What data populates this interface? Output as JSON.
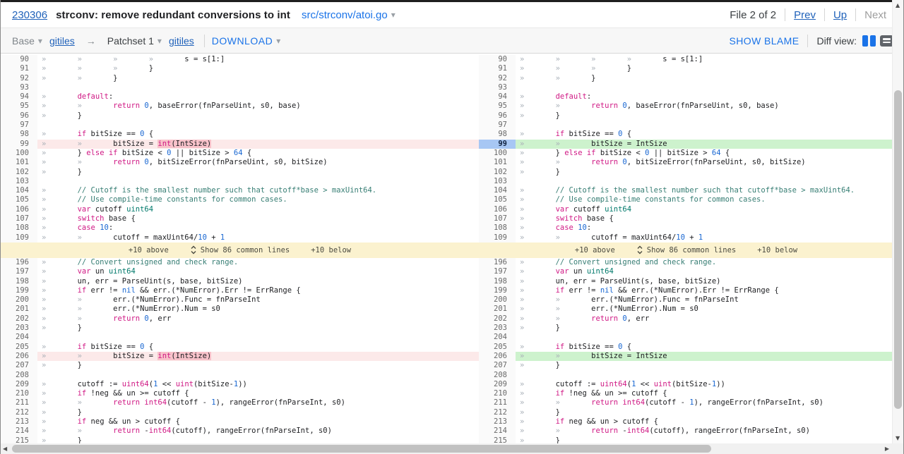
{
  "header": {
    "change_number": "230306",
    "title": "strconv: remove redundant conversions to int",
    "file_path": "src/strconv/atoi.go",
    "file_counter": "File 2 of 2",
    "prev": "Prev",
    "up": "Up",
    "next": "Next"
  },
  "toolbar": {
    "base_label": "Base",
    "gitiles_left": "gitiles",
    "arrow": "→",
    "patchset_label": "Patchset 1",
    "gitiles_right": "gitiles",
    "download": "DOWNLOAD",
    "show_blame": "SHOW BLAME",
    "diff_view_label": "Diff view:"
  },
  "colors": {
    "keyword": "#d01884",
    "number": "#1967d2",
    "type_teal": "#00796b",
    "comment": "#377e74",
    "link_blue": "#2062ba",
    "action_blue": "#1a73e8",
    "removed_bg": "#fce9e9",
    "removed_intraline": "#f8c2ca",
    "added_bg": "#cdf2cd",
    "expand_bg": "#fbf2cf",
    "selected_line_bg": "#a7c7f4",
    "gutter_bg": "#fafafa"
  },
  "diff": {
    "expand": {
      "above": "+10 above",
      "show": "Show 86 common lines",
      "below": "+10 below"
    },
    "rows": [
      {
        "n": 90,
        "s": [
          [
            "tab",
            "»       »       »       »       "
          ],
          [
            "p",
            "s = s[1:]"
          ]
        ]
      },
      {
        "n": 91,
        "s": [
          [
            "tab",
            "»       »       »       "
          ],
          [
            "p",
            "}"
          ]
        ]
      },
      {
        "n": 92,
        "s": [
          [
            "tab",
            "»       »       "
          ],
          [
            "p",
            "}"
          ]
        ]
      },
      {
        "n": 93,
        "s": []
      },
      {
        "n": 94,
        "s": [
          [
            "tab",
            "»       "
          ],
          [
            "k",
            "default"
          ],
          [
            "p",
            ":"
          ]
        ]
      },
      {
        "n": 95,
        "s": [
          [
            "tab",
            "»       »       "
          ],
          [
            "k",
            "return"
          ],
          [
            "p",
            " "
          ],
          [
            "n",
            "0"
          ],
          [
            "p",
            ", baseError(fnParseUint, s0, base)"
          ]
        ]
      },
      {
        "n": 96,
        "s": [
          [
            "tab",
            "»       "
          ],
          [
            "p",
            "}"
          ]
        ]
      },
      {
        "n": 97,
        "s": []
      },
      {
        "n": 98,
        "s": [
          [
            "tab",
            "»       "
          ],
          [
            "k",
            "if"
          ],
          [
            "p",
            " bitSize == "
          ],
          [
            "n",
            "0"
          ],
          [
            "p",
            " {"
          ]
        ]
      },
      {
        "n": 99,
        "lt": "removed",
        "rt": "added",
        "rsel": true,
        "ls": [
          [
            "tab",
            "»       »       "
          ],
          [
            "p",
            "bitSize = "
          ],
          [
            "kh",
            "int"
          ],
          [
            "ph",
            "(IntSize)"
          ]
        ],
        "rs": [
          [
            "tab",
            "»       »       "
          ],
          [
            "p",
            "bitSize = IntSize"
          ]
        ]
      },
      {
        "n": 100,
        "s": [
          [
            "tab",
            "»       "
          ],
          [
            "p",
            "} "
          ],
          [
            "k",
            "else"
          ],
          [
            "p",
            " "
          ],
          [
            "k",
            "if"
          ],
          [
            "p",
            " bitSize < "
          ],
          [
            "n",
            "0"
          ],
          [
            "p",
            " || bitSize > "
          ],
          [
            "n",
            "64"
          ],
          [
            "p",
            " {"
          ]
        ]
      },
      {
        "n": 101,
        "s": [
          [
            "tab",
            "»       »       "
          ],
          [
            "k",
            "return"
          ],
          [
            "p",
            " "
          ],
          [
            "n",
            "0"
          ],
          [
            "p",
            ", bitSizeError(fnParseUint, s0, bitSize)"
          ]
        ]
      },
      {
        "n": 102,
        "s": [
          [
            "tab",
            "»       "
          ],
          [
            "p",
            "}"
          ]
        ]
      },
      {
        "n": 103,
        "s": []
      },
      {
        "n": 104,
        "s": [
          [
            "tab",
            "»       "
          ],
          [
            "c",
            "// Cutoff is the smallest number such that cutoff*base > maxUint64."
          ]
        ]
      },
      {
        "n": 105,
        "s": [
          [
            "tab",
            "»       "
          ],
          [
            "c",
            "// Use compile-time constants for common cases."
          ]
        ]
      },
      {
        "n": 106,
        "s": [
          [
            "tab",
            "»       "
          ],
          [
            "k",
            "var"
          ],
          [
            "p",
            " cutoff "
          ],
          [
            "t",
            "uint64"
          ]
        ]
      },
      {
        "n": 107,
        "s": [
          [
            "tab",
            "»       "
          ],
          [
            "k",
            "switch"
          ],
          [
            "p",
            " base {"
          ]
        ]
      },
      {
        "n": 108,
        "s": [
          [
            "tab",
            "»       "
          ],
          [
            "k",
            "case"
          ],
          [
            "p",
            " "
          ],
          [
            "n",
            "10"
          ],
          [
            "p",
            ":"
          ]
        ]
      },
      {
        "n": 109,
        "s": [
          [
            "tab",
            "»       »       "
          ],
          [
            "p",
            "cutoff = maxUint64/"
          ],
          [
            "n",
            "10"
          ],
          [
            "p",
            " + "
          ],
          [
            "n",
            "1"
          ]
        ]
      },
      {
        "expand": true
      },
      {
        "n": 196,
        "s": [
          [
            "tab",
            "»       "
          ],
          [
            "c",
            "// Convert unsigned and check range."
          ]
        ]
      },
      {
        "n": 197,
        "s": [
          [
            "tab",
            "»       "
          ],
          [
            "k",
            "var"
          ],
          [
            "p",
            " un "
          ],
          [
            "t",
            "uint64"
          ]
        ]
      },
      {
        "n": 198,
        "s": [
          [
            "tab",
            "»       "
          ],
          [
            "p",
            "un, err = ParseUint(s, base, bitSize)"
          ]
        ]
      },
      {
        "n": 199,
        "s": [
          [
            "tab",
            "»       "
          ],
          [
            "k",
            "if"
          ],
          [
            "p",
            " err != "
          ],
          [
            "n",
            "nil"
          ],
          [
            "p",
            " && err.(*NumError).Err != ErrRange {"
          ]
        ]
      },
      {
        "n": 200,
        "s": [
          [
            "tab",
            "»       »       "
          ],
          [
            "p",
            "err.(*NumError).Func = fnParseInt"
          ]
        ]
      },
      {
        "n": 201,
        "s": [
          [
            "tab",
            "»       »       "
          ],
          [
            "p",
            "err.(*NumError).Num = s0"
          ]
        ]
      },
      {
        "n": 202,
        "s": [
          [
            "tab",
            "»       »       "
          ],
          [
            "k",
            "return"
          ],
          [
            "p",
            " "
          ],
          [
            "n",
            "0"
          ],
          [
            "p",
            ", err"
          ]
        ]
      },
      {
        "n": 203,
        "s": [
          [
            "tab",
            "»       "
          ],
          [
            "p",
            "}"
          ]
        ]
      },
      {
        "n": 204,
        "s": []
      },
      {
        "n": 205,
        "s": [
          [
            "tab",
            "»       "
          ],
          [
            "k",
            "if"
          ],
          [
            "p",
            " bitSize == "
          ],
          [
            "n",
            "0"
          ],
          [
            "p",
            " {"
          ]
        ]
      },
      {
        "n": 206,
        "lt": "removed",
        "rt": "added",
        "ls": [
          [
            "tab",
            "»       »       "
          ],
          [
            "p",
            "bitSize = "
          ],
          [
            "kh",
            "int"
          ],
          [
            "ph",
            "(IntSize)"
          ]
        ],
        "rs": [
          [
            "tab",
            "»       »       "
          ],
          [
            "p",
            "bitSize = IntSize"
          ]
        ]
      },
      {
        "n": 207,
        "s": [
          [
            "tab",
            "»       "
          ],
          [
            "p",
            "}"
          ]
        ]
      },
      {
        "n": 208,
        "s": []
      },
      {
        "n": 209,
        "s": [
          [
            "tab",
            "»       "
          ],
          [
            "p",
            "cutoff := "
          ],
          [
            "k",
            "uint64"
          ],
          [
            "p",
            "("
          ],
          [
            "n",
            "1"
          ],
          [
            "p",
            " << "
          ],
          [
            "k",
            "uint"
          ],
          [
            "p",
            "(bitSize-"
          ],
          [
            "n",
            "1"
          ],
          [
            "p",
            "))"
          ]
        ]
      },
      {
        "n": 210,
        "s": [
          [
            "tab",
            "»       "
          ],
          [
            "k",
            "if"
          ],
          [
            "p",
            " !neg && un >= cutoff {"
          ]
        ]
      },
      {
        "n": 211,
        "s": [
          [
            "tab",
            "»       »       "
          ],
          [
            "k",
            "return"
          ],
          [
            "p",
            " "
          ],
          [
            "k",
            "int64"
          ],
          [
            "p",
            "(cutoff - "
          ],
          [
            "n",
            "1"
          ],
          [
            "p",
            "), rangeError(fnParseInt, s0)"
          ]
        ]
      },
      {
        "n": 212,
        "s": [
          [
            "tab",
            "»       "
          ],
          [
            "p",
            "}"
          ]
        ]
      },
      {
        "n": 213,
        "s": [
          [
            "tab",
            "»       "
          ],
          [
            "k",
            "if"
          ],
          [
            "p",
            " neg && un > cutoff {"
          ]
        ]
      },
      {
        "n": 214,
        "s": [
          [
            "tab",
            "»       »       "
          ],
          [
            "k",
            "return"
          ],
          [
            "p",
            " -"
          ],
          [
            "k",
            "int64"
          ],
          [
            "p",
            "(cutoff), rangeError(fnParseInt, s0)"
          ]
        ]
      },
      {
        "n": 215,
        "s": [
          [
            "tab",
            "»       "
          ],
          [
            "p",
            "}"
          ]
        ]
      }
    ]
  }
}
